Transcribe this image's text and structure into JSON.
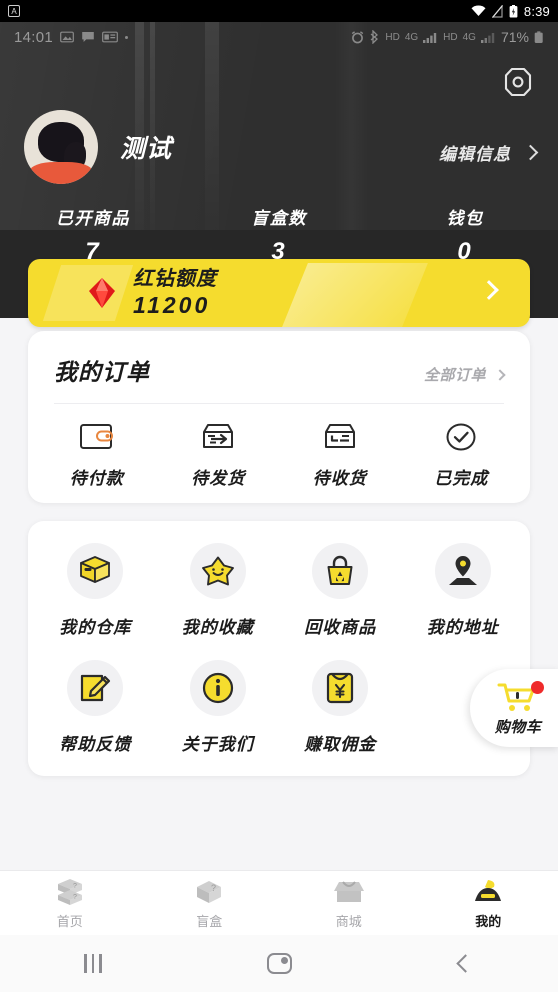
{
  "device_status": {
    "app_badge": "A",
    "time": "8:39",
    "icons": [
      "wifi-icon",
      "signal-off-icon",
      "battery-charging-icon"
    ]
  },
  "app_status": {
    "time": "14:01",
    "battery_percent": "71%",
    "network_labels": [
      "HD",
      "4G",
      "HD",
      "4G"
    ],
    "icons": [
      "image-icon",
      "message-icon",
      "card-icon",
      "dot-icon",
      "alarm-icon",
      "bluetooth-icon",
      "battery-icon"
    ]
  },
  "header": {
    "settings_icon": "hexagon-gear-icon",
    "username": "测试",
    "avatar": "user-avatar",
    "edit_label": "编辑信息",
    "stats": [
      {
        "label": "已开商品",
        "value": "7"
      },
      {
        "label": "盲盒数",
        "value": "3"
      },
      {
        "label": "钱包",
        "value": "0"
      }
    ]
  },
  "vip_banner": {
    "icon": "red-diamond-icon",
    "title": "红钻额度",
    "amount": "11200",
    "bg_color": "#f5dc2e"
  },
  "orders": {
    "title": "我的订单",
    "all_label": "全部订单",
    "items": [
      {
        "label": "待付款",
        "icon": "wallet-icon"
      },
      {
        "label": "待发货",
        "icon": "box-arrow-icon"
      },
      {
        "label": "待收货",
        "icon": "box-receive-icon"
      },
      {
        "label": "已完成",
        "icon": "check-circle-icon"
      }
    ]
  },
  "grid": {
    "row1": [
      {
        "label": "我的仓库",
        "icon": "box-3d-icon"
      },
      {
        "label": "我的收藏",
        "icon": "star-icon"
      },
      {
        "label": "回收商品",
        "icon": "recycle-bag-icon"
      },
      {
        "label": "我的地址",
        "icon": "location-pin-icon"
      }
    ],
    "row2": [
      {
        "label": "帮助反馈",
        "icon": "edit-note-icon"
      },
      {
        "label": "关于我们",
        "icon": "info-circle-icon"
      },
      {
        "label": "赚取佣金",
        "icon": "red-envelope-yen-icon"
      }
    ]
  },
  "cart_fab": {
    "label": "购物车",
    "icon": "shopping-cart-icon",
    "badge": ""
  },
  "tabbar": {
    "items": [
      {
        "label": "首页",
        "icon": "boxes-icon",
        "active": false
      },
      {
        "label": "盲盒",
        "icon": "mystery-box-icon",
        "active": false
      },
      {
        "label": "商城",
        "icon": "shop-icon",
        "active": false
      },
      {
        "label": "我的",
        "icon": "profile-icon",
        "active": true
      }
    ],
    "active_color": "#f5dc2e"
  },
  "navbar": {
    "recents_label": "recents",
    "home_label": "home",
    "back_label": "back"
  }
}
